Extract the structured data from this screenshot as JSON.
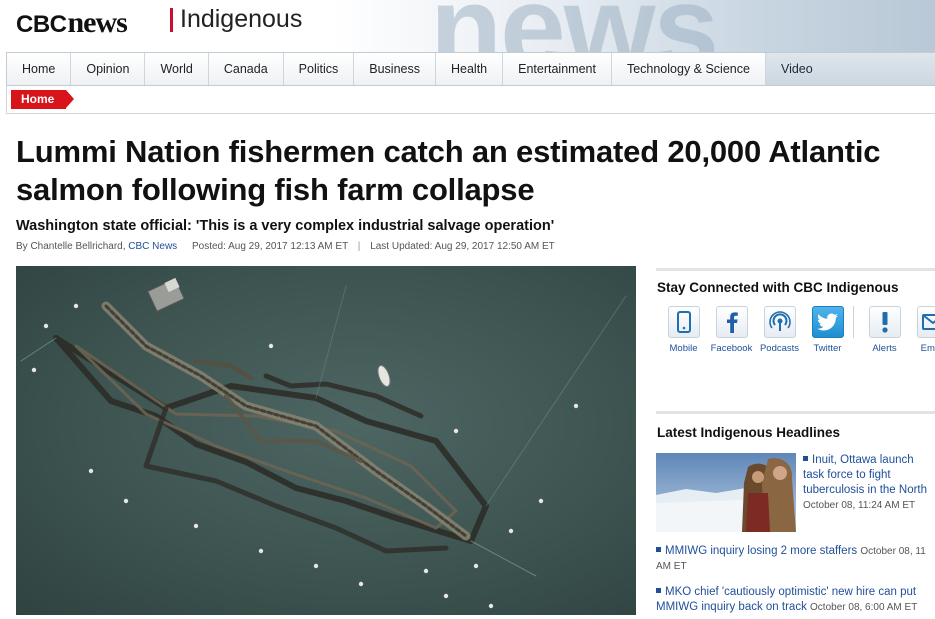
{
  "masthead": {
    "logo_cbc": "CBC",
    "logo_news": "news",
    "section": "Indigenous",
    "background_word": "news"
  },
  "nav": {
    "items": [
      "Home",
      "Opinion",
      "World",
      "Canada",
      "Politics",
      "Business",
      "Health",
      "Entertainment",
      "Technology & Science",
      "Video"
    ]
  },
  "breadcrumb": {
    "label": "Home"
  },
  "article": {
    "headline": "Lummi Nation fishermen catch an estimated 20,000 Atlantic salmon following fish farm collapse",
    "subhead": "Washington state official: 'This is a very complex industrial salvage operation'",
    "byline_prefix": "By Chantelle Bellrichard,",
    "byline_outlet": "CBC News",
    "posted": "Posted: Aug 29, 2017 12:13 AM ET",
    "separator": "|",
    "updated": "Last Updated: Aug 29, 2017 12:50 AM ET"
  },
  "sidebar": {
    "stay_connected_title": "Stay Connected with CBC Indigenous",
    "social": [
      {
        "label": "Mobile",
        "icon": "mobile-icon"
      },
      {
        "label": "Facebook",
        "icon": "facebook-icon"
      },
      {
        "label": "Podcasts",
        "icon": "podcast-icon"
      },
      {
        "label": "Twitter",
        "icon": "twitter-icon"
      },
      {
        "label": "Alerts",
        "icon": "alert-icon"
      },
      {
        "label": "Email",
        "icon": "email-icon"
      }
    ],
    "headlines_title": "Latest Indigenous Headlines",
    "headlines": [
      {
        "title": "Inuit, Ottawa launch task force to fight tuberculosis in the North",
        "date": "October 08, 11:24 AM ET"
      },
      {
        "title": "MMIWG inquiry losing 2 more staffers",
        "date": "October 08, 11 AM ET"
      },
      {
        "title": "MKO chief 'cautiously optimistic' new hire can put MMIWG inquiry back on track",
        "date": "October 08, 6:00 AM ET"
      }
    ]
  },
  "colors": {
    "brand_red": "#d8141b",
    "link_blue": "#1f4f99",
    "water": "#3d5451"
  }
}
